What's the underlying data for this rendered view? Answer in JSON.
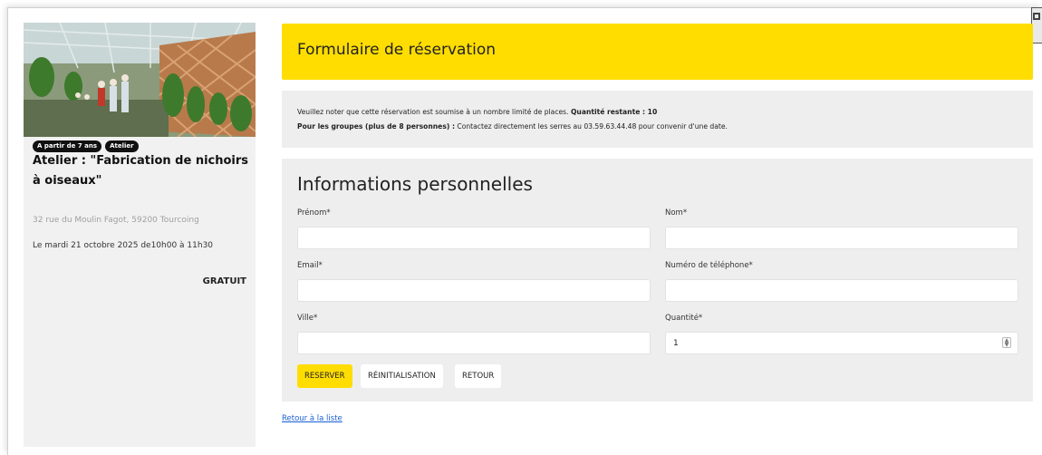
{
  "event": {
    "badges": [
      "A partir de 7 ans",
      "Atelier"
    ],
    "title": "Atelier : \"Fabrication de nichoirs à oiseaux\"",
    "address": "32 rue du Moulin Fagot, 59200 Tourcoing",
    "date": "Le mardi 21 octobre 2025 de10h00 à 11h30",
    "price": "GRATUIT"
  },
  "header": {
    "title": "Formulaire de réservation"
  },
  "notice": {
    "line1_text": "Veuillez noter que cette réservation est soumise à un nombre limité de places. ",
    "line1_bold": "Quantité restante : 10",
    "line2_bold": "Pour les groupes (plus de 8 personnes) :",
    "line2_text": " Contactez directement les serres au 03.59.63.44.48 pour convenir d'une date."
  },
  "form": {
    "title": "Informations personnelles",
    "fields": {
      "prenom": {
        "label": "Prénom*",
        "value": ""
      },
      "nom": {
        "label": "Nom*",
        "value": ""
      },
      "email": {
        "label": "Email*",
        "value": ""
      },
      "telephone": {
        "label": "Numéro de téléphone*",
        "value": ""
      },
      "ville": {
        "label": "Ville*",
        "value": ""
      },
      "quantite": {
        "label": "Quantité*",
        "value": "1"
      }
    },
    "buttons": {
      "reserve": "RESERVER",
      "reset": "RÉINITIALISATION",
      "back": "RETOUR"
    }
  },
  "back_link": "Retour à la liste",
  "colors": {
    "accent": "#ffdd00",
    "panel": "#eeeeee",
    "link": "#1a5fd6"
  }
}
